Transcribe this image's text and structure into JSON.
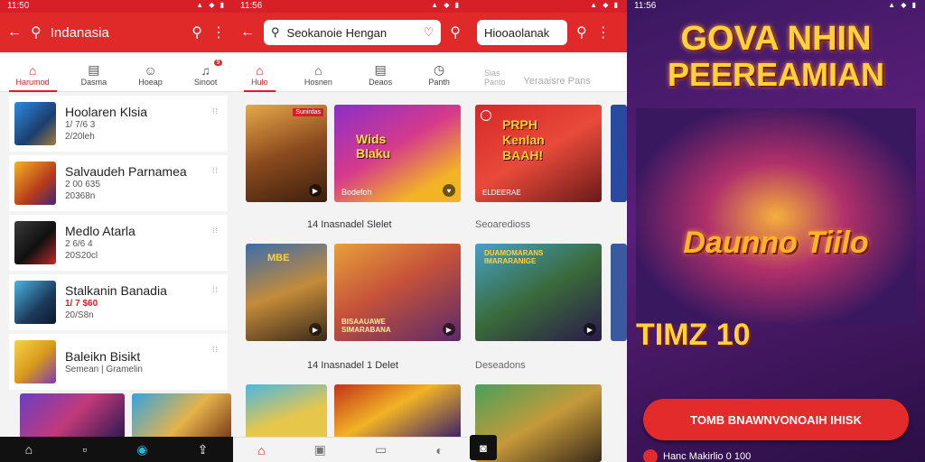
{
  "colors": {
    "accent": "#e02a2a",
    "active_tab": "#d61f26"
  },
  "status": {
    "time_left": "11:50",
    "time_mid": "11:56",
    "time_right": "11:56"
  },
  "panel1": {
    "title": "Indanasia",
    "tabs": [
      {
        "label": "Harumod",
        "icon": "home-icon"
      },
      {
        "label": "Dasma",
        "icon": "list-icon"
      },
      {
        "label": "Hoeap",
        "icon": "person-icon"
      },
      {
        "label": "Sinoot",
        "icon": "bell-icon",
        "badge": "9"
      }
    ],
    "items": [
      {
        "name": "Hoolaren Klsia",
        "line1": "1/ 7/6 3",
        "line2": "2/20leh"
      },
      {
        "name": "Salvaudeh Parnamea",
        "line1": "2 00 635",
        "line2": "20368n"
      },
      {
        "name": "Medlo Atarla",
        "line1": "2 6/6 4",
        "line2": "20S20cl"
      },
      {
        "name": "Stalkanin Banadia",
        "line1": "1/ 7 $60",
        "line2": "20/S8n"
      },
      {
        "name": "Baleikn Bisikt",
        "line1": "Semean | Gramelin"
      }
    ]
  },
  "panel2": {
    "search": "Seokanoie Hengan",
    "tabs": [
      {
        "label": "Hulo"
      },
      {
        "label": "Hosnen"
      },
      {
        "label": "Deaos"
      },
      {
        "label": "Panth"
      }
    ],
    "section1": "14 Inasnadel Slelet",
    "section2": "14 Inasnadel 1 Delet",
    "tile2_title": "Wids\nBlaku",
    "tile1_badge": "Sunirdas",
    "tile2_caption": "Bodefoh",
    "tile4_title": "MBE",
    "tile5_title": "BISAAUAWE\nSIMARABANA"
  },
  "panel3": {
    "search": "Hiooaolanak",
    "tabs": [
      {
        "label": "Sias\nPanto"
      },
      {
        "label": "Yeraaisre Pans"
      }
    ],
    "promo_title": "PRPH\nKenlan\nBAAH!",
    "promo_tag": "ELDEERAE",
    "section1": "Seoaredioss",
    "section2": "Deseadons",
    "tile2_title": "DUAMOMARANS\nIMARARANIGE"
  },
  "panel4": {
    "title_line1": "GOVA NHIN",
    "title_line2": "PEEREAMIAN",
    "subtitle": "Daunno Tiilo",
    "badge": "TIMZ 10",
    "cta": "TOMB BNAWNVONOAIH IHISK",
    "footer": "Hanc Makirlio 0 100"
  }
}
